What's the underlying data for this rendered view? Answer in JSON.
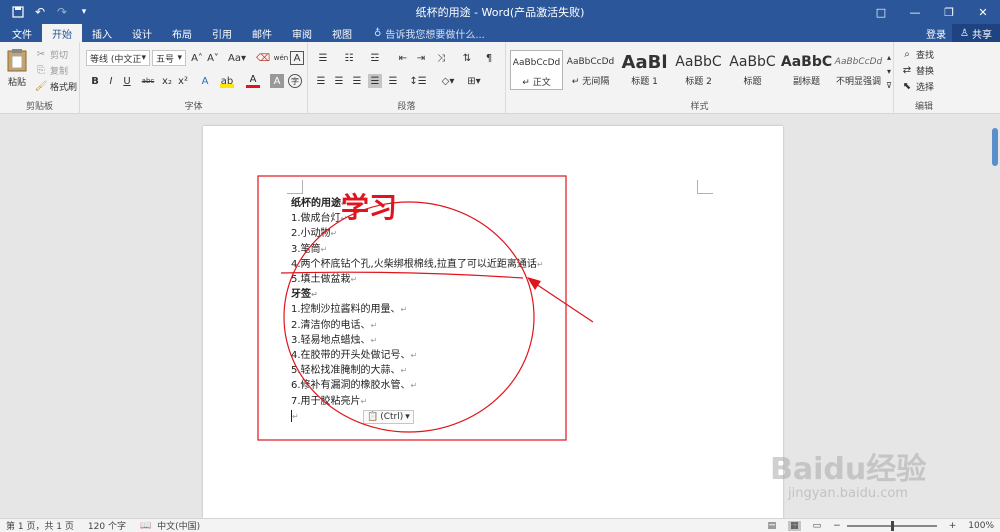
{
  "window": {
    "title": "纸杯的用途 - Word(产品激活失败)",
    "controls": [
      "□",
      "—",
      "❐",
      "✕"
    ]
  },
  "quick_access": [
    "save-icon",
    "undo-icon",
    "redo-icon",
    "customize-icon"
  ],
  "tabs": [
    "文件",
    "开始",
    "插入",
    "设计",
    "布局",
    "引用",
    "邮件",
    "审阅",
    "视图"
  ],
  "active_tab": "开始",
  "tell_me": "告诉我您想要做什么...",
  "account": {
    "login": "登录",
    "share": "共享"
  },
  "ribbon": {
    "clipboard": {
      "label": "剪贴板",
      "paste": "粘贴",
      "cut": "剪切",
      "copy": "复制",
      "painter": "格式刷"
    },
    "font": {
      "label": "字体",
      "name": "等线 (中文正文",
      "size": "五号",
      "buttons": [
        "B",
        "I",
        "U",
        "abc",
        "x₂",
        "x²"
      ]
    },
    "paragraph": {
      "label": "段落"
    },
    "styles": {
      "label": "样式",
      "items": [
        {
          "preview": "AaBbCcDd",
          "name": "↵ 正文"
        },
        {
          "preview": "AaBbCcDd",
          "name": "↵ 无间隔"
        },
        {
          "preview": "AaBl",
          "name": "标题 1"
        },
        {
          "preview": "AaBbC",
          "name": "标题 2"
        },
        {
          "preview": "AaBbC",
          "name": "标题"
        },
        {
          "preview": "AaBbC",
          "name": "副标题"
        },
        {
          "preview": "AaBbCcDd",
          "name": "不明显强调"
        }
      ]
    },
    "editing": {
      "label": "编辑",
      "find": "查找",
      "replace": "替换",
      "select": "选择"
    }
  },
  "document": {
    "annotation_text": "学习",
    "lines": [
      {
        "text": "纸杯的用途",
        "bold": true
      },
      {
        "text": "1.做成台灯",
        "bold": false
      },
      {
        "text": "2.小动物",
        "bold": false
      },
      {
        "text": "3.笔筒",
        "bold": false
      },
      {
        "text": "4.两个杯底钻个孔,火柴绑根棉线,拉直了可以近距离通话",
        "bold": false
      },
      {
        "text": "5.填土做盆栽",
        "bold": false
      },
      {
        "text": "牙签",
        "bold": true
      },
      {
        "text": "1.控制沙拉酱料的用量、",
        "bold": false
      },
      {
        "text": "2.清洁你的电话、",
        "bold": false
      },
      {
        "text": "3.轻易地点蜡烛、",
        "bold": false
      },
      {
        "text": "4.在胶带的开头处做记号、",
        "bold": false
      },
      {
        "text": "5.轻松找准腌制的大蒜、",
        "bold": false
      },
      {
        "text": "6.修补有漏洞的橡胶水管、",
        "bold": false
      },
      {
        "text": "7.用于胶粘亮片",
        "bold": false
      }
    ],
    "paste_options": "(Ctrl)"
  },
  "status": {
    "page": "第 1 页，共 1 页",
    "words": "120 个字",
    "language": "中文(中国)",
    "zoom": "100%"
  },
  "watermark": {
    "main": "Baidu经验",
    "sub": "jingyan.baidu.com"
  }
}
